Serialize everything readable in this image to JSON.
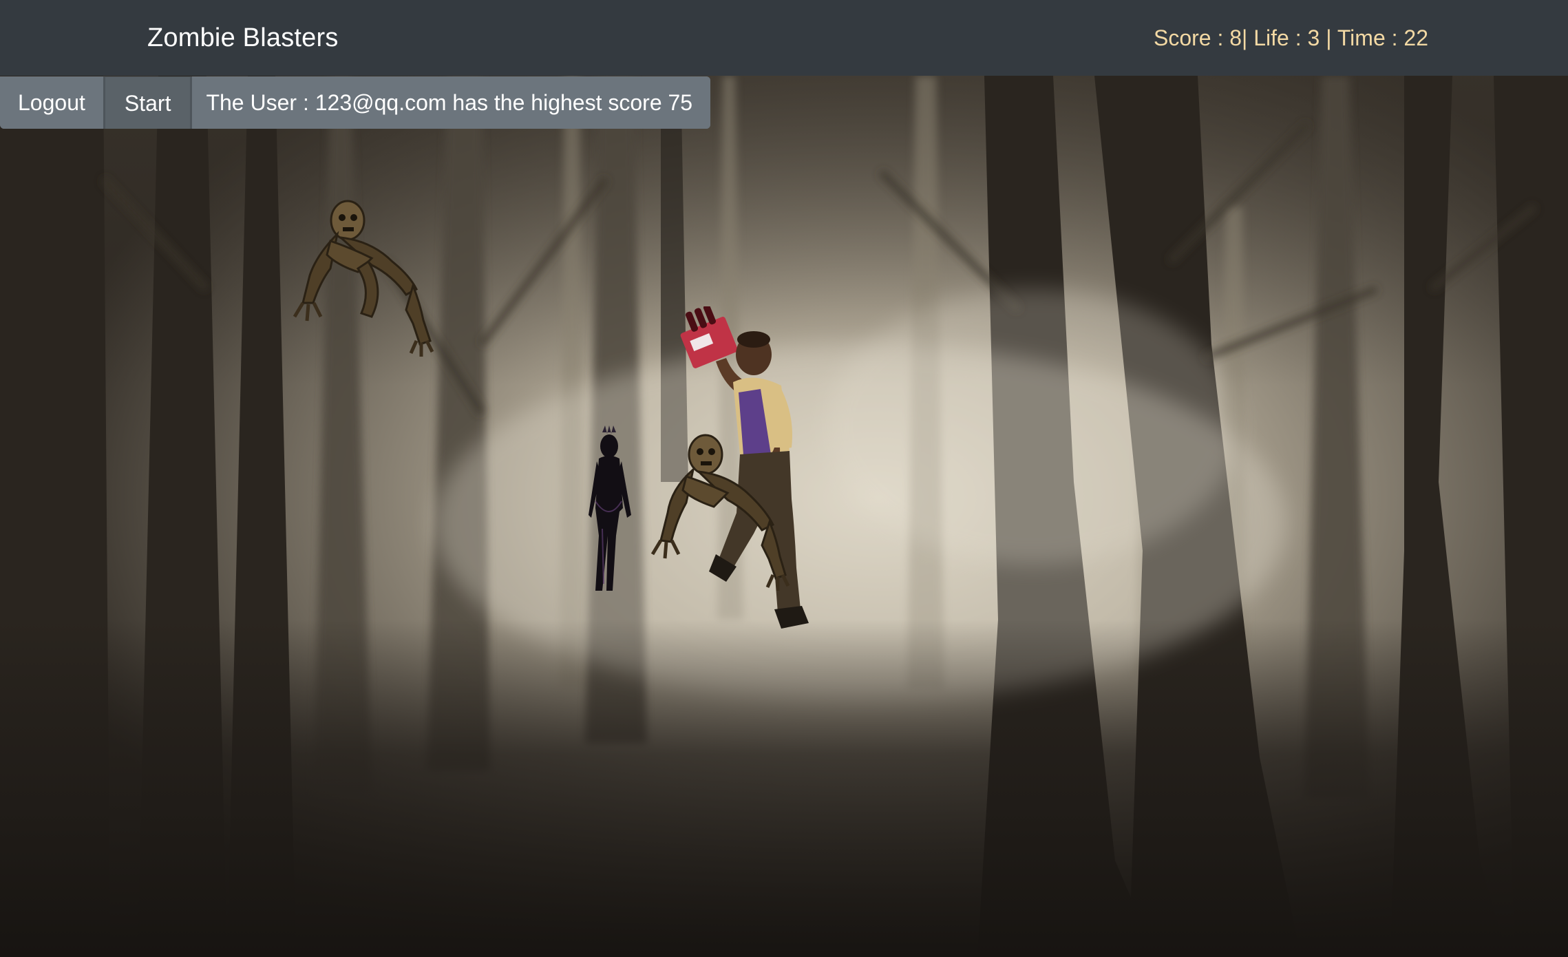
{
  "navbar": {
    "brand": "Zombie Blasters",
    "score_label": "Score : ",
    "score": "8",
    "life_label": "| Life : ",
    "life": "3",
    "time_label": " | Time : ",
    "time": "22"
  },
  "toolbar": {
    "logout_label": "Logout",
    "start_label": "Start",
    "highscore_text": "The User : 123@qq.com has the highest score 75"
  },
  "sprites": [
    {
      "name": "crawling-zombie",
      "icon": "zombie-icon"
    },
    {
      "name": "crawling-zombie",
      "icon": "zombie-icon"
    },
    {
      "name": "shadow-demon",
      "icon": "demon-icon"
    },
    {
      "name": "survivor-with-soda",
      "icon": "survivor-icon"
    }
  ],
  "colors": {
    "navbar_bg": "#343a40",
    "stats_text": "#f3d9a4",
    "button_bg": "#6c757d",
    "button_active_bg": "#5a6268",
    "fog": "#d8d0c0"
  }
}
